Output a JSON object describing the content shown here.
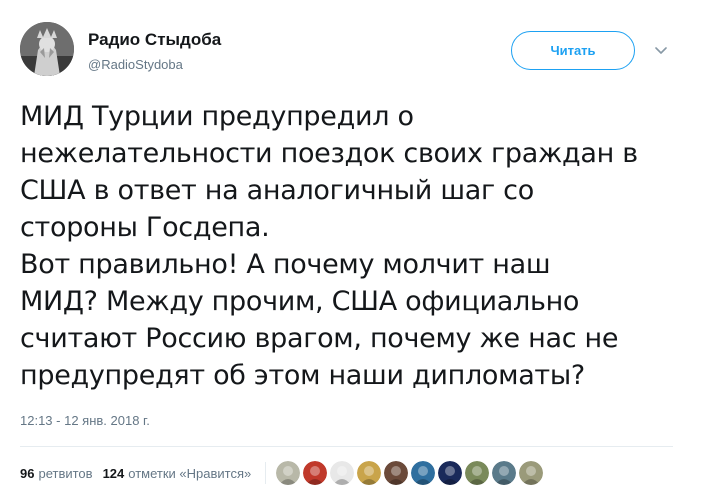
{
  "author": {
    "name": "Радио Стыдоба",
    "handle": "@RadioStydoba",
    "avatar_icon": "liberty-statue-avatar-icon"
  },
  "follow_button": {
    "label": "Читать"
  },
  "tweet": {
    "lines": [
      "МИД Турции предупредил о",
      "нежелательности поездок своих граждан в",
      "США в ответ на аналогичный шаг со",
      "стороны Госдепа.",
      "Вот правильно! А почему молчит наш",
      "МИД? Между прочим, США официально",
      "считают Россию врагом, почему же нас не",
      "предупредят об этом наши дипломаты?"
    ],
    "timestamp": "12:13 - 12 янв. 2018 г."
  },
  "stats": {
    "retweets_count": "96",
    "retweets_label": "ретвитов",
    "likes_count": "124",
    "likes_label": "отметки «Нравится»"
  },
  "likers": [
    {
      "icon": "liker-avatar-1-icon",
      "color": "#b8b8a8"
    },
    {
      "icon": "liker-avatar-2-icon",
      "color": "#c0392b"
    },
    {
      "icon": "liker-avatar-3-icon",
      "color": "#e8e8e8"
    },
    {
      "icon": "liker-avatar-4-icon",
      "color": "#c9a44a"
    },
    {
      "icon": "liker-avatar-5-icon",
      "color": "#6b4a3a"
    },
    {
      "icon": "liker-avatar-6-icon",
      "color": "#2f6f9f"
    },
    {
      "icon": "liker-avatar-7-icon",
      "color": "#1a2a5a"
    },
    {
      "icon": "liker-avatar-8-icon",
      "color": "#7a8a5a"
    },
    {
      "icon": "liker-avatar-9-icon",
      "color": "#5a7a8a"
    },
    {
      "icon": "liker-avatar-10-icon",
      "color": "#9a9a7a"
    }
  ],
  "colors": {
    "accent": "#1da1f2",
    "text": "#14171a",
    "secondary": "#657786"
  }
}
